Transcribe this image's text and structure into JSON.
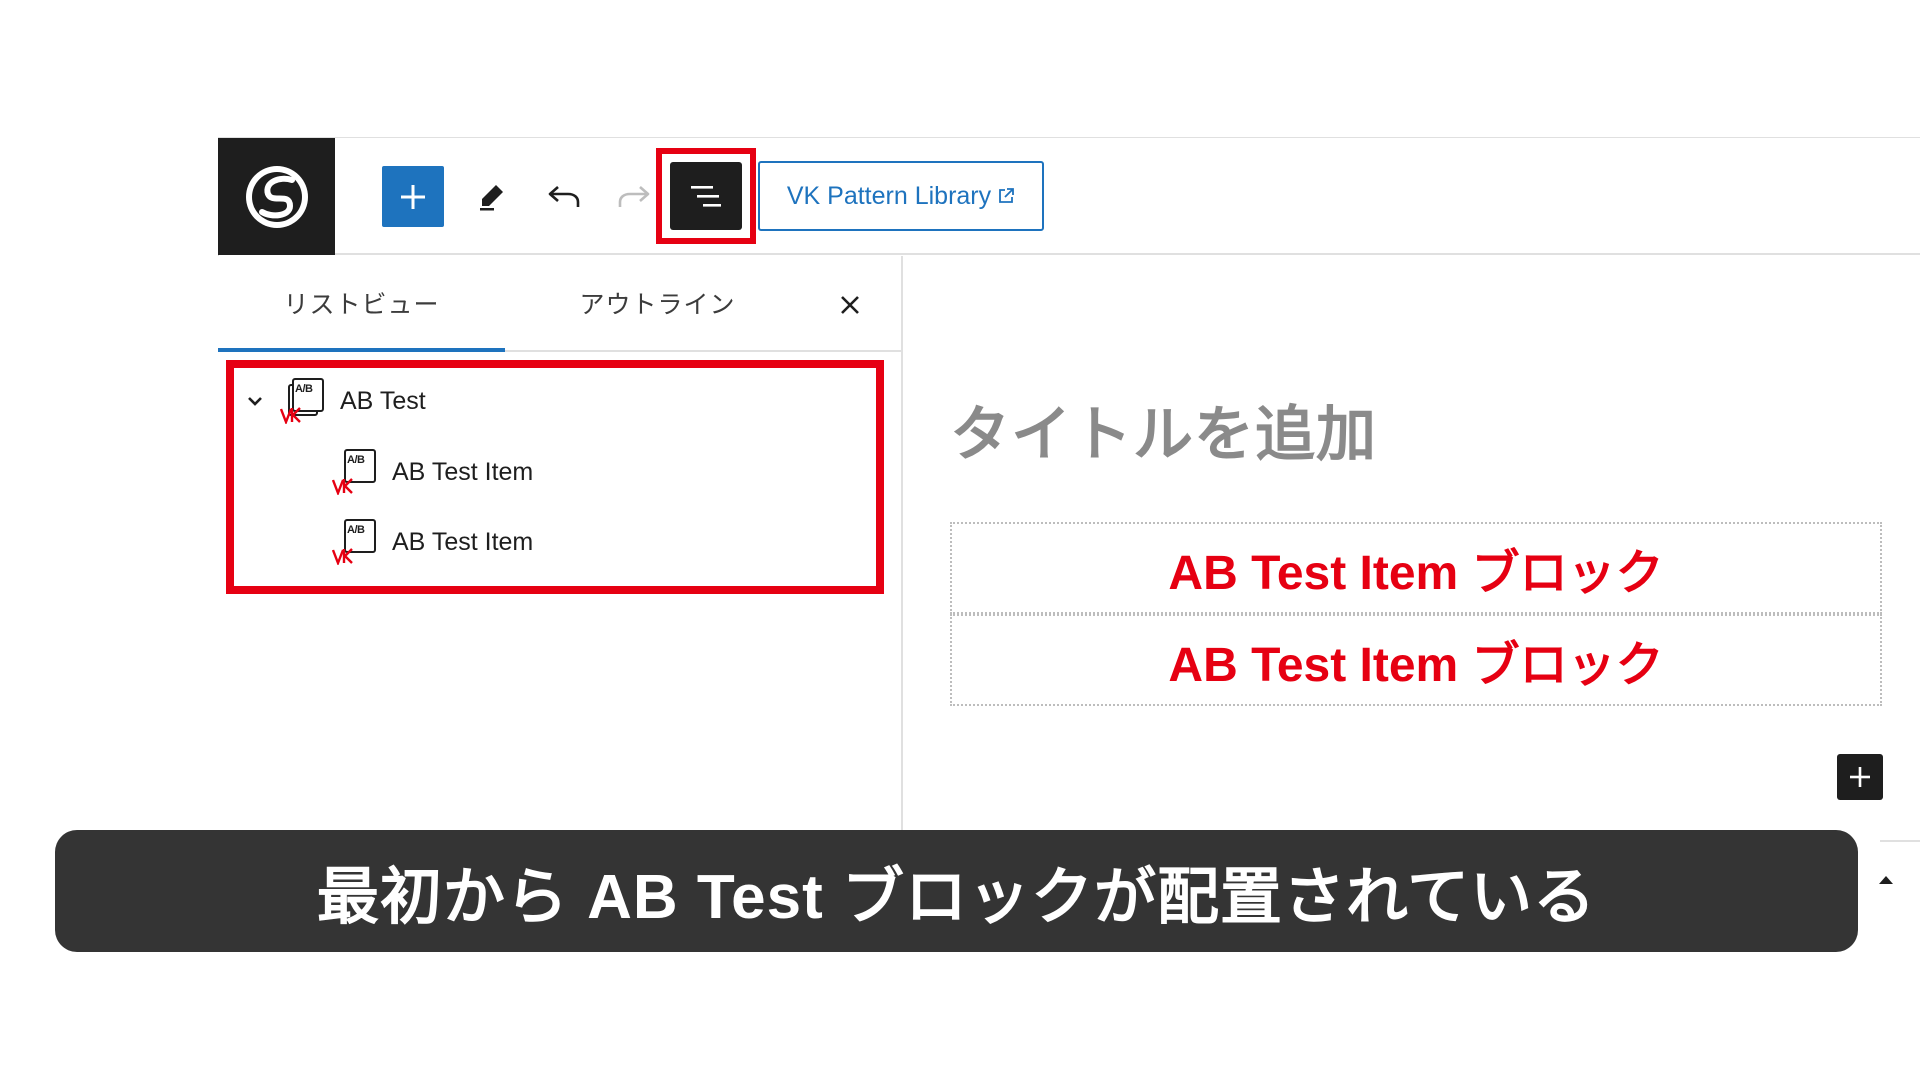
{
  "toolbar": {
    "logo_icon": "site-logo-icon",
    "inserter_icon": "plus-icon",
    "tools_icon": "pencil-icon",
    "undo_icon": "undo-icon",
    "redo_icon": "redo-icon",
    "list_view_icon": "list-view-icon",
    "pattern_library_label": "VK Pattern Library",
    "pattern_library_icon": "external-link-icon"
  },
  "panel": {
    "tabs": [
      {
        "label": "リストビュー",
        "active": true
      },
      {
        "label": "アウトライン",
        "active": false
      }
    ],
    "close_icon": "close-icon",
    "tree": [
      {
        "label": "AB Test",
        "icon": "ab-test-icon",
        "expanded": true
      },
      {
        "label": "AB Test Item",
        "icon": "ab-test-item-icon"
      },
      {
        "label": "AB Test Item",
        "icon": "ab-test-item-icon"
      }
    ]
  },
  "canvas": {
    "title_placeholder": "タイトルを追加",
    "blocks": [
      {
        "label": "AB Test Item ブロック"
      },
      {
        "label": "AB Test Item ブロック"
      }
    ],
    "appender_icon": "plus-icon"
  },
  "caption": "最初から AB Test ブロックが配置されている",
  "colors": {
    "accent": "#1e73be",
    "highlight": "#e60012",
    "dark": "#1e1e1e",
    "caption_bg": "#343434",
    "placeholder": "#8a8a8a"
  }
}
